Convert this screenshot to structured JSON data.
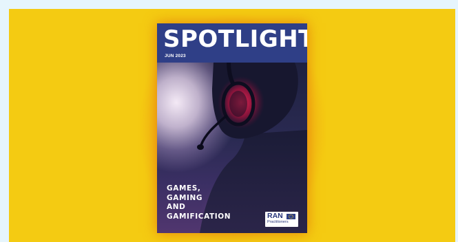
{
  "colors": {
    "page_background": "#e6f5fc",
    "panel_background": "#f4cb12",
    "cover_header": "#2f3f87",
    "glow": "#ee8812"
  },
  "cover": {
    "title": "SPOTLIGHT",
    "date": "JUN 2023",
    "headline_lines": [
      "GAMES,",
      "GAMING",
      "AND",
      "GAMIFICATION"
    ],
    "logo": {
      "name": "RAN",
      "subtitle": "Practitioners",
      "icon": "eu-flag-icon"
    },
    "photo_subject": "person-wearing-gaming-headset-image"
  }
}
